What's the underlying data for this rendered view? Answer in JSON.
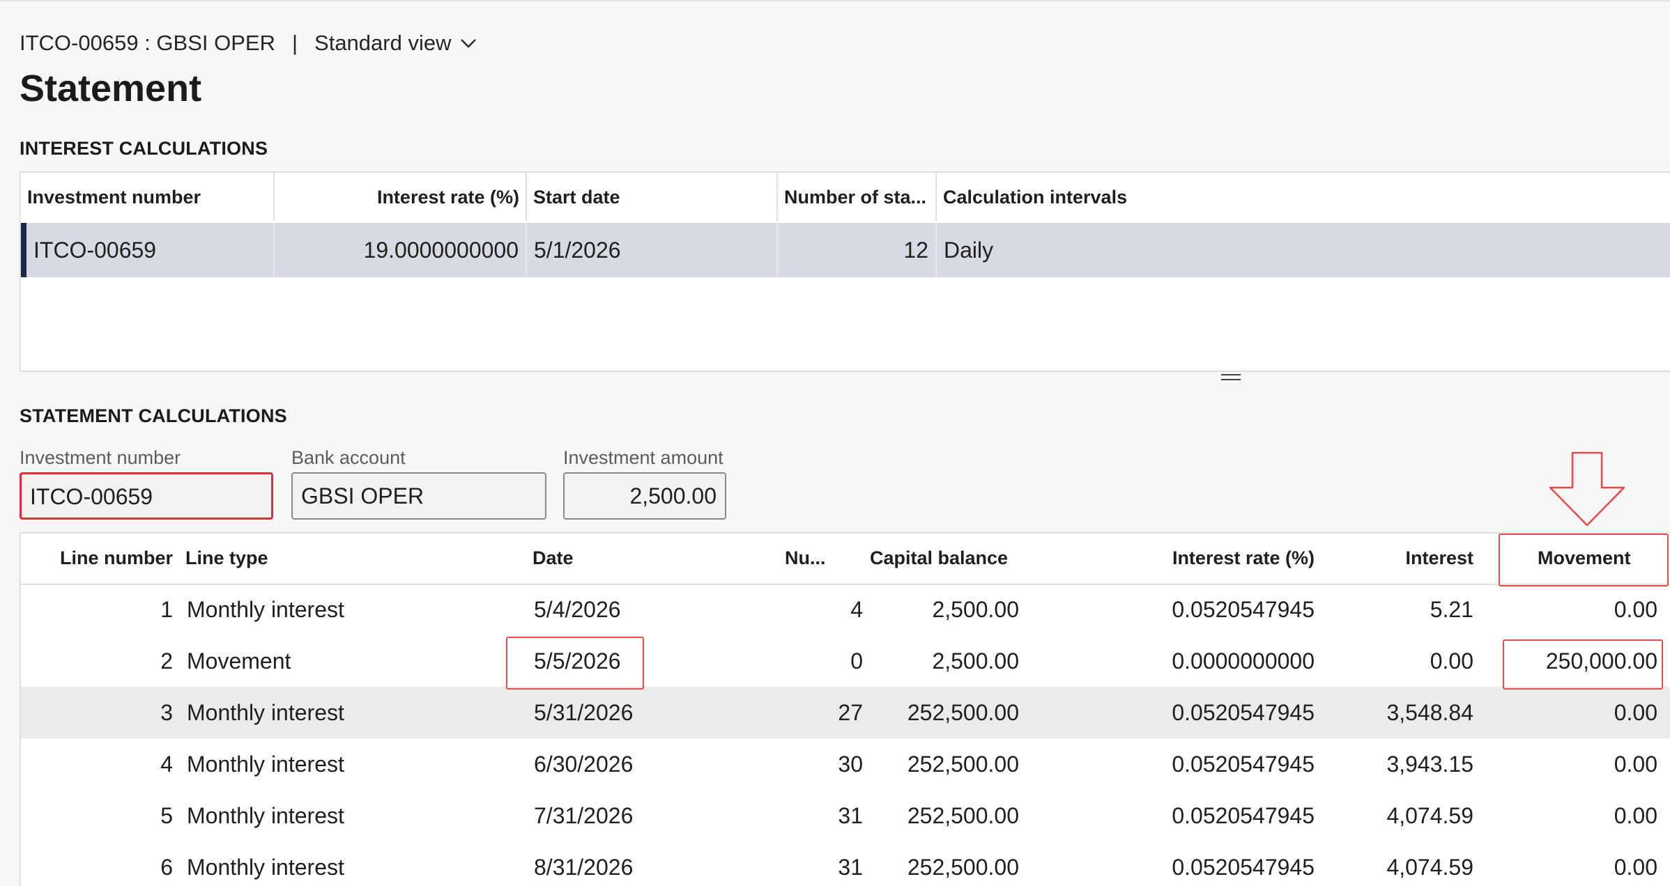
{
  "header": {
    "record": "ITCO-00659 : GBSI OPER",
    "separator": "|",
    "view": "Standard view",
    "page_title": "Statement"
  },
  "interest_calculations": {
    "section_title": "INTEREST CALCULATIONS",
    "columns": [
      "Investment number",
      "Interest rate (%)",
      "Start date",
      "Number of sta...",
      "Calculation intervals"
    ],
    "rows": [
      {
        "investment_number": "ITCO-00659",
        "interest_rate": "19.0000000000",
        "start_date": "5/1/2026",
        "number_of_statements": "12",
        "calculation_intervals": "Daily"
      }
    ]
  },
  "statement_calculations": {
    "section_title": "STATEMENT CALCULATIONS",
    "fields": {
      "investment_number_label": "Investment number",
      "investment_number_value": "ITCO-00659",
      "bank_account_label": "Bank account",
      "bank_account_value": "GBSI OPER",
      "investment_amount_label": "Investment amount",
      "investment_amount_value": "2,500.00"
    },
    "columns": [
      "Line number",
      "Line type",
      "Date",
      "Nu...",
      "Capital balance",
      "Interest rate (%)",
      "Interest",
      "Movement"
    ],
    "rows": [
      {
        "line": "1",
        "type": "Monthly interest",
        "date": "5/4/2026",
        "num": "4",
        "capital": "2,500.00",
        "rate": "0.0520547945",
        "interest": "5.21",
        "movement": "0.00"
      },
      {
        "line": "2",
        "type": "Movement",
        "date": "5/5/2026",
        "num": "0",
        "capital": "2,500.00",
        "rate": "0.0000000000",
        "interest": "0.00",
        "movement": "250,000.00"
      },
      {
        "line": "3",
        "type": "Monthly interest",
        "date": "5/31/2026",
        "num": "27",
        "capital": "252,500.00",
        "rate": "0.0520547945",
        "interest": "3,548.84",
        "movement": "0.00"
      },
      {
        "line": "4",
        "type": "Monthly interest",
        "date": "6/30/2026",
        "num": "30",
        "capital": "252,500.00",
        "rate": "0.0520547945",
        "interest": "3,943.15",
        "movement": "0.00"
      },
      {
        "line": "5",
        "type": "Monthly interest",
        "date": "7/31/2026",
        "num": "31",
        "capital": "252,500.00",
        "rate": "0.0520547945",
        "interest": "4,074.59",
        "movement": "0.00"
      },
      {
        "line": "6",
        "type": "Monthly interest",
        "date": "8/31/2026",
        "num": "31",
        "capital": "252,500.00",
        "rate": "0.0520547945",
        "interest": "4,074.59",
        "movement": "0.00"
      }
    ]
  },
  "icons": {
    "view_dropdown": "chevron-down-icon",
    "splitter": "splitter-handle-icon",
    "annotation": "red-down-arrow-icon"
  },
  "colors": {
    "selected_row": "#d7dae2",
    "row_marker": "#1b2a4a",
    "annotation_red": "#e84a4a",
    "alt_row": "#edebe9"
  }
}
